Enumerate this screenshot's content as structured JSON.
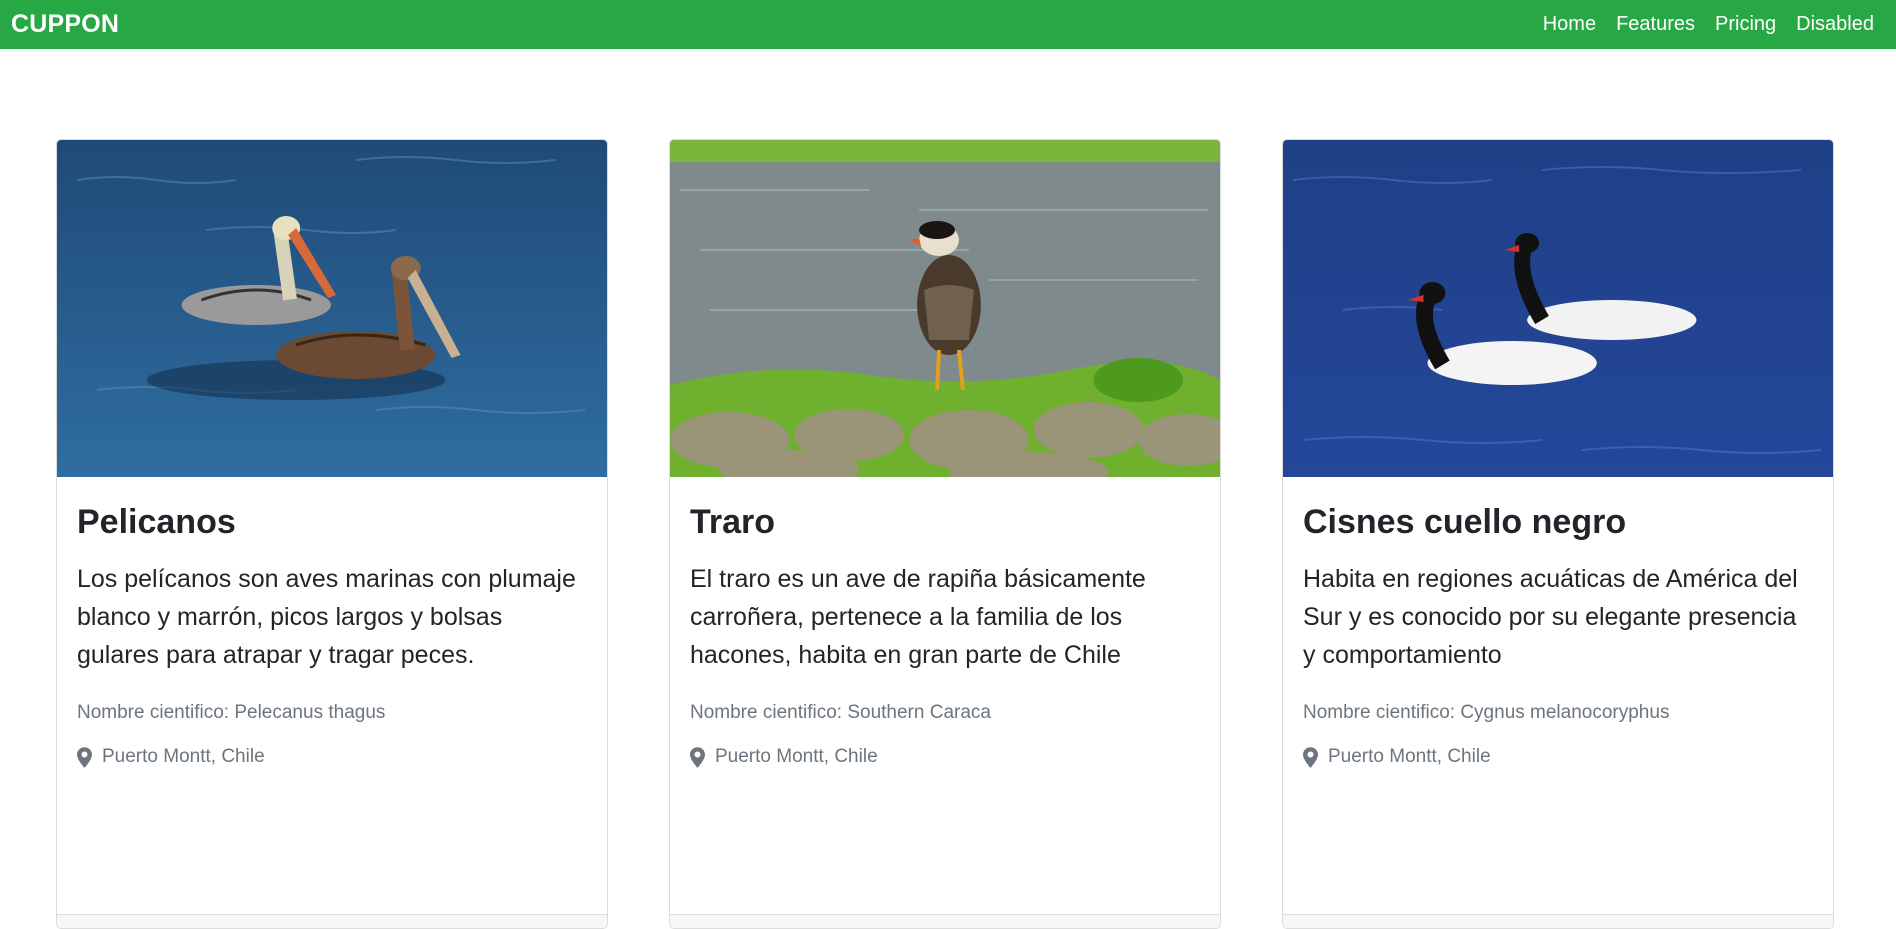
{
  "navbar": {
    "brand": "CUPPON",
    "links": [
      "Home",
      "Features",
      "Pricing",
      "Disabled"
    ],
    "bg_color": "#28a745"
  },
  "cards": [
    {
      "image": "pelicans-on-water",
      "title": "Pelicanos",
      "text": "Los pelícanos son aves marinas con plumaje blanco y marrón, picos largos y bolsas gulares para atrapar y tragar peces.",
      "scientific": "Nombre cientifico: Pelecanus thagus",
      "location": "Puerto Montt, Chile",
      "location_icon": "map-marker-icon"
    },
    {
      "image": "caracara-on-rocks",
      "title": "Traro",
      "text": "El traro es un ave de rapiña básicamente carroñera, pertenece a la familia de los hacones, habita en gran parte de Chile",
      "scientific": "Nombre cientifico: Southern Caraca",
      "location": "Puerto Montt, Chile",
      "location_icon": "map-marker-icon"
    },
    {
      "image": "black-necked-swans",
      "title": "Cisnes cuello negro",
      "text": "Habita en regiones acuáticas de América del Sur y es conocido por su elegante presencia y comportamiento",
      "scientific": "Nombre cientifico: Cygnus melanocoryphus",
      "location": "Puerto Montt, Chile",
      "location_icon": "map-marker-icon"
    }
  ]
}
